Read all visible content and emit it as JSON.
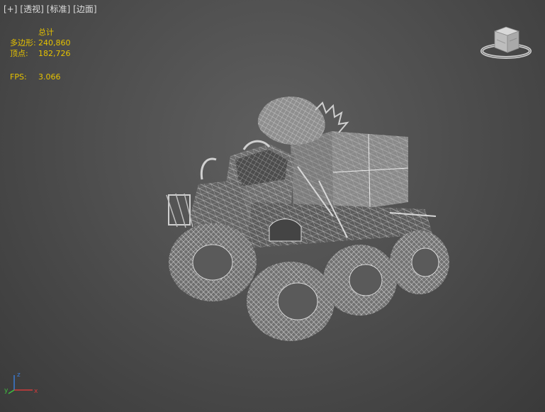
{
  "viewport": {
    "labels": [
      "[+]",
      "[透视]",
      "[标准]",
      "[边面]"
    ]
  },
  "stats": {
    "header": "总计",
    "polygons_label": "多边形:",
    "polygons_value": "240,860",
    "vertices_label": "顶点:",
    "vertices_value": "182,726",
    "fps_label": "FPS:",
    "fps_value": "3.066"
  },
  "axis": {
    "z": "z",
    "y": "y",
    "x": "x"
  },
  "colors": {
    "stats_text": "#e6c200",
    "axis_x": "#d23a3a",
    "axis_y": "#3fbf3f",
    "axis_z": "#3a7bd5"
  },
  "icons": {
    "viewcube": "viewcube-icon",
    "axis_gizmo": "axis-tripod-icon",
    "model": "wireframe-monster-truck"
  }
}
